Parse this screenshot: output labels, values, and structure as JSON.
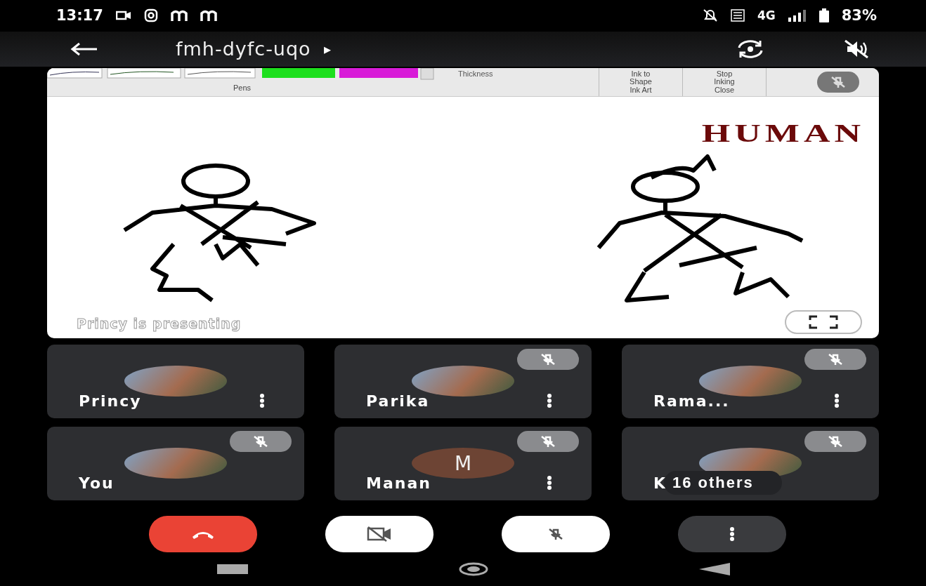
{
  "status_bar": {
    "time": "13:17",
    "network": "4G",
    "battery": "83%"
  },
  "header": {
    "meeting_code": "fmh-dyfc-uqo",
    "expand_glyph": "▸"
  },
  "presentation": {
    "ribbon": {
      "pens_label": "Pens",
      "thickness_label": "Thickness",
      "ink_to_shape": "Ink to Shape",
      "ink_art": "Ink Art",
      "stop_inking": "Stop Inking",
      "close": "Close"
    },
    "slide_title": "HUMAN",
    "caption": "Princy is presenting",
    "muted": true
  },
  "participants": [
    {
      "name": "Princy",
      "muted": false,
      "kind": "photo",
      "menu": true
    },
    {
      "name": "Parika",
      "muted": true,
      "kind": "photo",
      "menu": true
    },
    {
      "name": "Rama...",
      "muted": true,
      "kind": "photo",
      "menu": true
    },
    {
      "name": "You",
      "muted": true,
      "kind": "photo",
      "menu": false
    },
    {
      "name": "Manan",
      "muted": true,
      "kind": "letter",
      "initial": "M",
      "menu": true
    },
    {
      "name": "K",
      "muted": true,
      "kind": "photo",
      "menu": false
    }
  ],
  "others_chip": "16 others",
  "controls": {
    "camera_on": false,
    "mic_on": false
  }
}
